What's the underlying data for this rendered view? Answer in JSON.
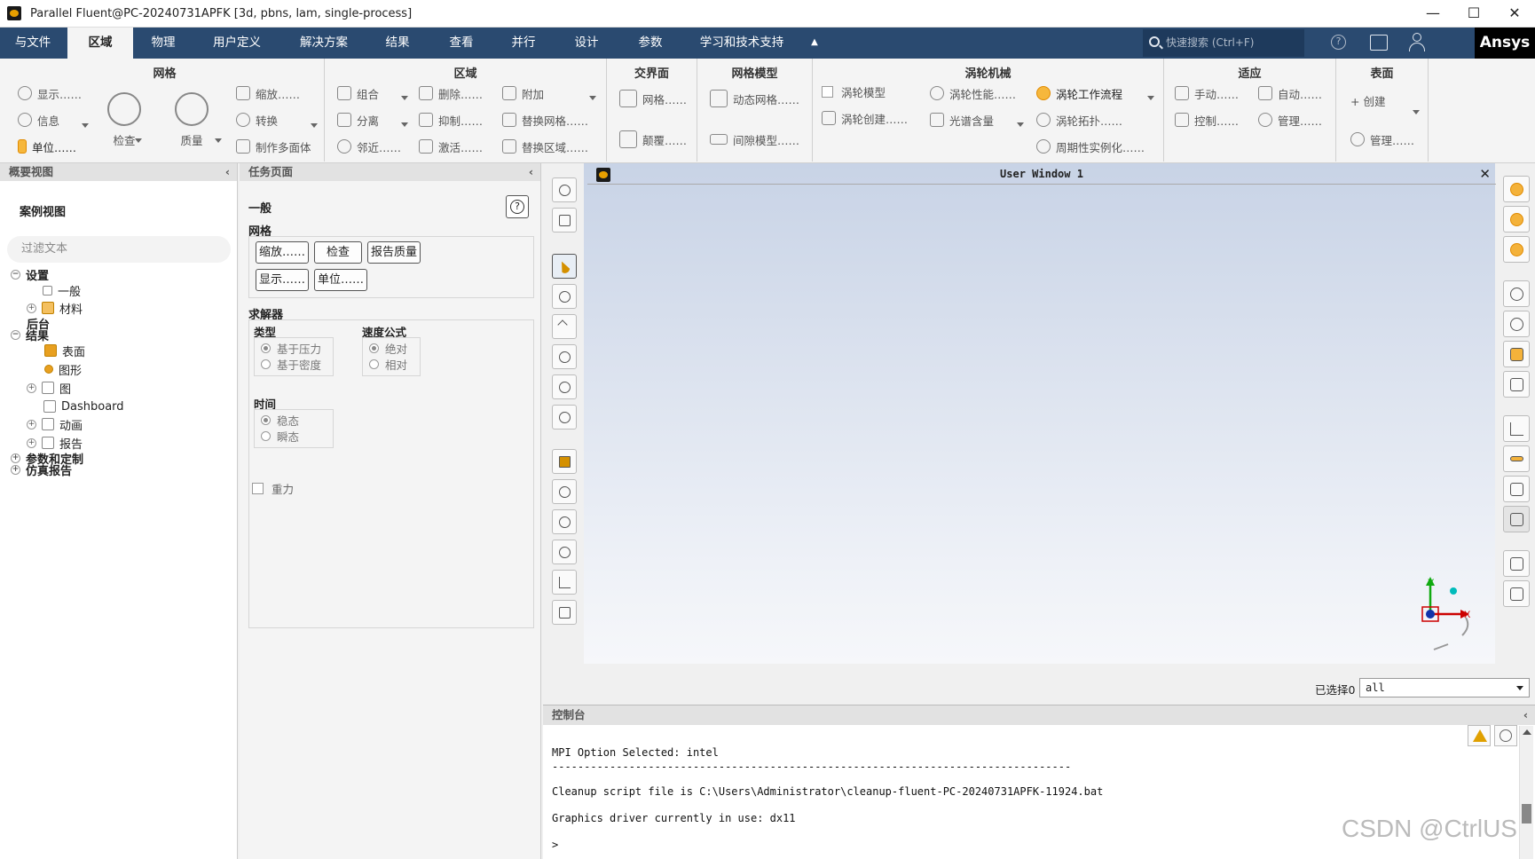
{
  "window": {
    "title": "Parallel Fluent@PC-20240731APFK  [3d, pbns, lam, single-process]",
    "minimize": "—",
    "maximize": "☐",
    "close": "✕"
  },
  "menu": {
    "items": [
      "与文件",
      "区域",
      "物理",
      "用户定义",
      "解决方案",
      "结果",
      "查看",
      "并行",
      "设计",
      "参数",
      "学习和技术支持"
    ],
    "active_index": 1,
    "overflow": "▲",
    "search_placeholder": "快速搜索 (Ctrl+F)",
    "brand": "Ansys",
    "accent": "#2a4a70"
  },
  "ribbon": {
    "mesh": {
      "title": "网格",
      "display": "显示……",
      "info": "信息",
      "units": "单位……",
      "check": "检查",
      "quality": "质量",
      "scale": "缩放……",
      "transform": "转换",
      "make_polyhedra": "制作多面体"
    },
    "zones": {
      "title": "区域",
      "combine": "组合",
      "separate": "分离",
      "adjacency": "邻近……",
      "delete": "删除……",
      "deactivate": "抑制……",
      "activate": "激活……",
      "append": "附加",
      "replace_mesh": "替换网格……",
      "replace_zone": "替换区域……"
    },
    "interfaces": {
      "title": "交界面",
      "mesh": "网格……",
      "overset": "颠覆……"
    },
    "mesh_models": {
      "title": "网格模型",
      "dynamic_mesh": "动态网格……",
      "gap_model": "间隙模型……"
    },
    "turbo": {
      "title": "涡轮机械",
      "turbo_model": "涡轮模型",
      "turbo_create": "涡轮创建……",
      "turbo_perf": "涡轮性能……",
      "spectral": "光谱含量",
      "turbo_workflow": "涡轮工作流程",
      "turbo_topology": "涡轮拓扑……",
      "periodic": "周期性实例化……"
    },
    "adapt": {
      "title": "适应",
      "manual": "手动……",
      "auto": "自动……",
      "control": "控制……",
      "manage": "管理……"
    },
    "surface": {
      "title": "表面",
      "create": "+ 创建",
      "manage": "管理……"
    }
  },
  "outline": {
    "header": "概要视图",
    "case_view": "案例视图",
    "filter_placeholder": "过滤文本",
    "tree": [
      {
        "label": "设置",
        "toggle": "−",
        "bold": true
      },
      {
        "label": "一般"
      },
      {
        "label": "材料",
        "toggle": "+"
      },
      {
        "label": "后台",
        "bold": true
      },
      {
        "label": "结果",
        "toggle": "−",
        "bold": true
      },
      {
        "label": "表面"
      },
      {
        "label": "图形"
      },
      {
        "label": "图",
        "toggle": "+"
      },
      {
        "label": "Dashboard"
      },
      {
        "label": "动画",
        "toggle": "+"
      },
      {
        "label": "报告",
        "toggle": "+"
      },
      {
        "label": "参数和定制",
        "toggle": "+",
        "bold": true
      },
      {
        "label": "仿真报告",
        "toggle": "+",
        "bold": true
      }
    ]
  },
  "task": {
    "header": "任务页面",
    "general": "一般",
    "help": "?",
    "mesh_label": "网格",
    "mesh_buttons": [
      "缩放……",
      "检查",
      "报告质量",
      "显示……",
      "单位……"
    ],
    "solver_label": "求解器",
    "type_label": "类型",
    "type_options": [
      "基于压力",
      "基于密度"
    ],
    "velocity_label": "速度公式",
    "velocity_options": [
      "绝对",
      "相对"
    ],
    "time_label": "时间",
    "time_options": [
      "稳态",
      "瞬态"
    ],
    "gravity": "重力"
  },
  "viewport": {
    "title": "User Window 1",
    "close": "✕",
    "axis_x": "X",
    "axis_y": "Y",
    "selected_label": "已选择0",
    "selected_value": "all"
  },
  "console": {
    "header": "控制台",
    "lines": [
      "MPI Option Selected: intel",
      "---------------------------------------------------------------------------------",
      "Cleanup script file is C:\\Users\\Administrator\\cleanup-fluent-PC-20240731APFK-11924.bat",
      "Graphics driver currently in use: dx11",
      ">"
    ]
  },
  "watermark": "CSDN @CtrlUS"
}
